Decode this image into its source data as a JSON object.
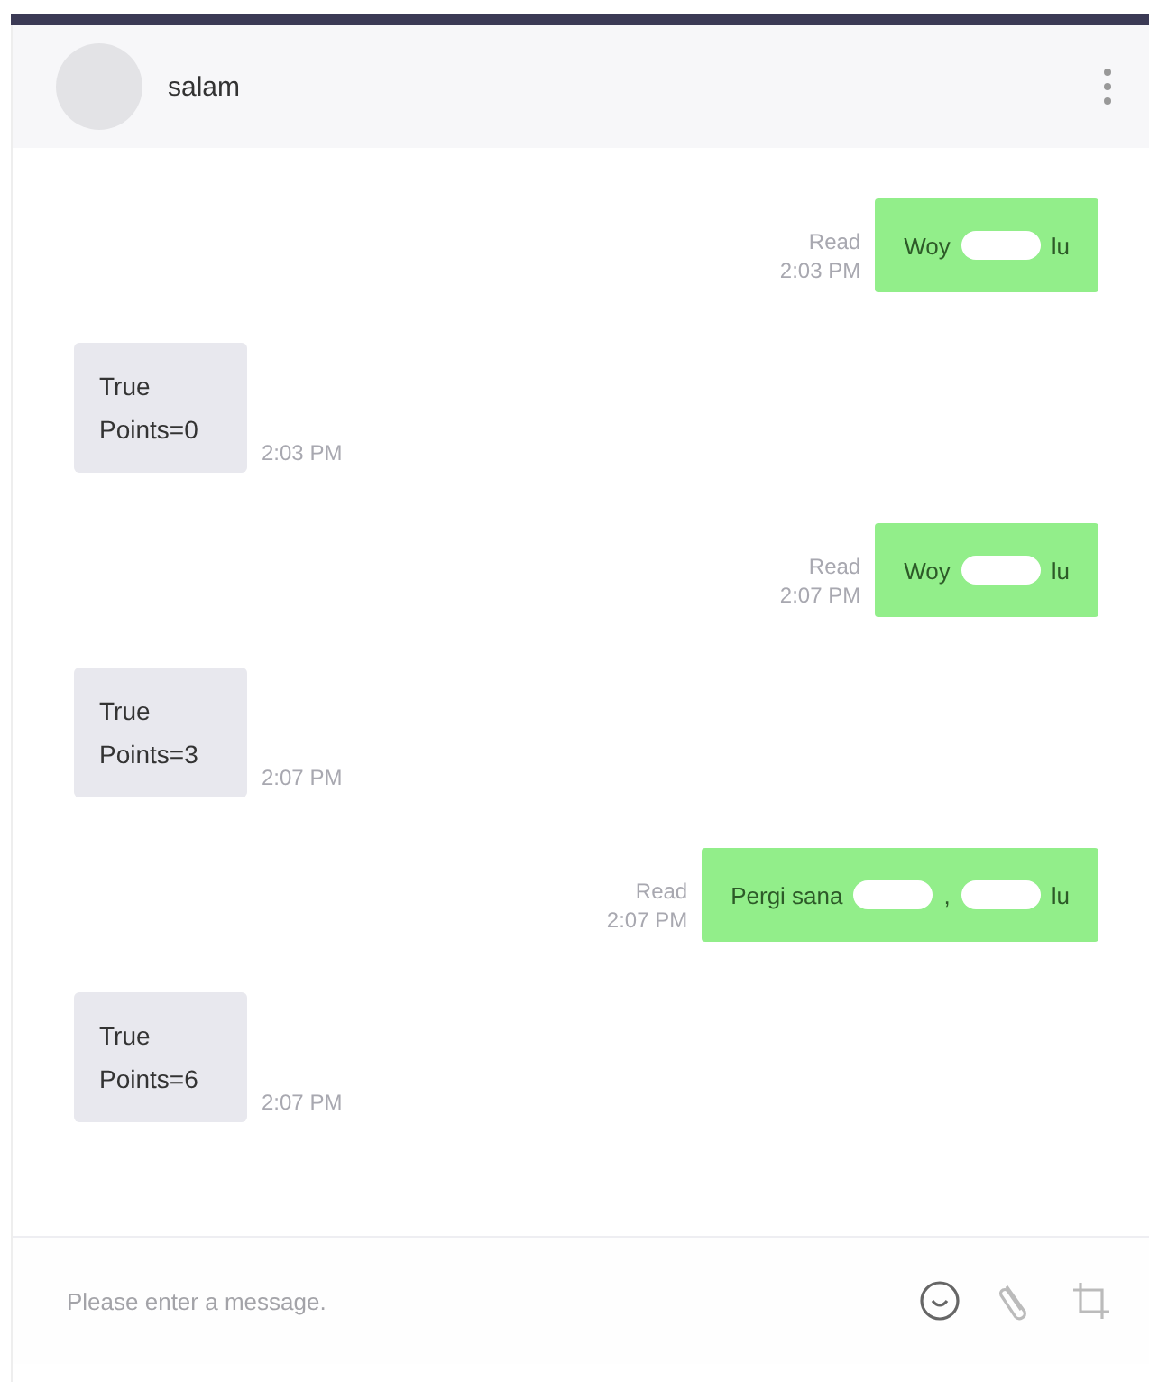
{
  "header": {
    "name": "salam"
  },
  "messages": [
    {
      "kind": "sent",
      "parts": [
        "Woy",
        "lu"
      ],
      "status": "Read",
      "time": "2:03 PM"
    },
    {
      "kind": "received",
      "lines": [
        "True",
        "Points=0"
      ],
      "time": "2:03 PM"
    },
    {
      "kind": "sent",
      "parts": [
        "Woy",
        "lu"
      ],
      "status": "Read",
      "time": "2:07 PM"
    },
    {
      "kind": "received",
      "lines": [
        "True",
        "Points=3"
      ],
      "time": "2:07 PM"
    },
    {
      "kind": "sent",
      "parts": [
        "Pergi sana",
        ",",
        "lu"
      ],
      "status": "Read",
      "time": "2:07 PM"
    },
    {
      "kind": "received",
      "lines": [
        "True",
        "Points=6"
      ],
      "time": "2:07 PM"
    }
  ],
  "composer": {
    "placeholder": "Please enter a message."
  }
}
